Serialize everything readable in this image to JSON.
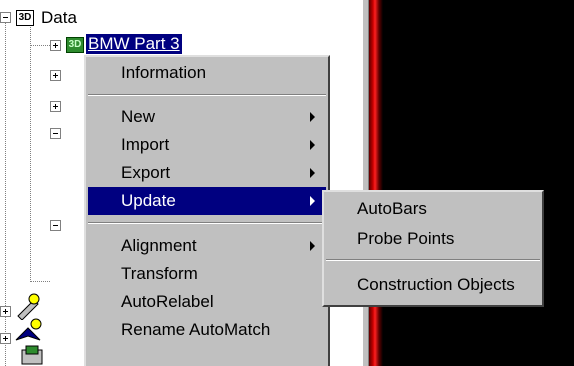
{
  "tree": {
    "root_label": "Data",
    "root_icon": "3d-data-icon",
    "selected_label": "BMW Part 3",
    "selected_icon": "3d-part-icon"
  },
  "context_menu": {
    "items": [
      {
        "label": "Information",
        "has_submenu": false
      },
      {
        "label": "New",
        "has_submenu": true
      },
      {
        "label": "Import",
        "has_submenu": true
      },
      {
        "label": "Export",
        "has_submenu": true
      },
      {
        "label": "Update",
        "has_submenu": true,
        "highlighted": true
      },
      {
        "label": "Alignment",
        "has_submenu": true
      },
      {
        "label": "Transform",
        "has_submenu": false
      },
      {
        "label": "AutoRelabel",
        "has_submenu": false
      },
      {
        "label": "Rename AutoMatch",
        "has_submenu": false
      }
    ]
  },
  "submenu": {
    "items": [
      {
        "label": "AutoBars"
      },
      {
        "label": "Probe Points"
      },
      {
        "label": "Construction Objects"
      }
    ]
  },
  "colors": {
    "menu_bg": "#c0c0c0",
    "highlight": "#000080",
    "viewport_bg": "#000000",
    "viewport_edge": "#ff2020"
  }
}
